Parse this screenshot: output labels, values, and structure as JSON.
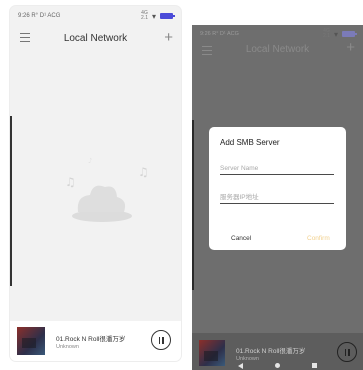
{
  "left": {
    "status": {
      "left_text": "9:26 R° D¹ ACG",
      "signal_text": "4G",
      "signal_sub": "2.1",
      "battery_text": "",
      "wifi_icon": "wifi-icon",
      "battery_icon": "battery-icon"
    },
    "header": {
      "title": "Local Network",
      "menu_icon": "menu-icon",
      "add_icon": "plus-icon"
    },
    "empty_state": {
      "icon": "music-cloud-icon"
    },
    "player": {
      "song": "01.Rock N Roll很潘万岁",
      "artist": "Unknown",
      "state": "playing"
    }
  },
  "right": {
    "status": {
      "left_text": "9:26 R° D¹ ACG",
      "signal_text": "4G",
      "signal_sub": "2.1"
    },
    "header": {
      "title": "Local Network"
    },
    "dialog": {
      "title": "Add SMB Server",
      "server_name_placeholder": "Server Name",
      "server_ip_placeholder": "服务器IP地址",
      "cancel_label": "Cancel",
      "confirm_label": "Confirm"
    },
    "player": {
      "song": "01.Rock N Roll很潘万岁",
      "artist": "Unknown"
    }
  },
  "colors": {
    "accent_confirm": "#f2d18f",
    "battery": "#4a4ad8"
  }
}
